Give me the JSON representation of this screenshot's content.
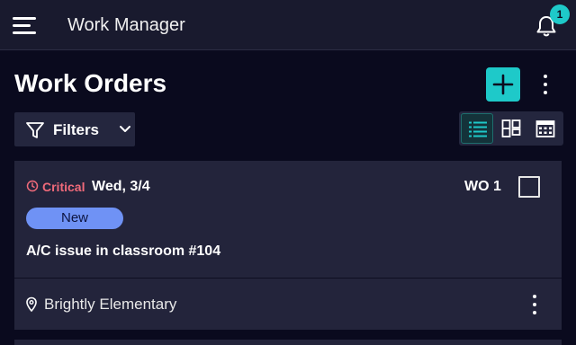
{
  "header": {
    "app_title": "Work Manager",
    "notification_count": "1"
  },
  "page": {
    "title": "Work Orders",
    "filters_label": "Filters",
    "view_modes": [
      "list",
      "board",
      "calendar"
    ],
    "active_view": "list"
  },
  "work_orders": [
    {
      "priority": "Critical",
      "due_date": "Wed, 3/4",
      "number": "WO 1",
      "status": "New",
      "title": "A/C issue in classroom #104",
      "location": "Brightly Elementary",
      "selected": false
    }
  ],
  "colors": {
    "background": "#0a0a1e",
    "app_bar": "#191a2e",
    "card": "#23243b",
    "accent": "#1ec9c9",
    "critical": "#f06a7a",
    "status_new": "#6f92f5"
  },
  "icons": [
    "menu-icon",
    "bell-icon",
    "plus-icon",
    "more-vertical-icon",
    "filter-icon",
    "chevron-down-icon",
    "list-view-icon",
    "board-view-icon",
    "calendar-view-icon",
    "clock-icon",
    "location-pin-icon"
  ]
}
